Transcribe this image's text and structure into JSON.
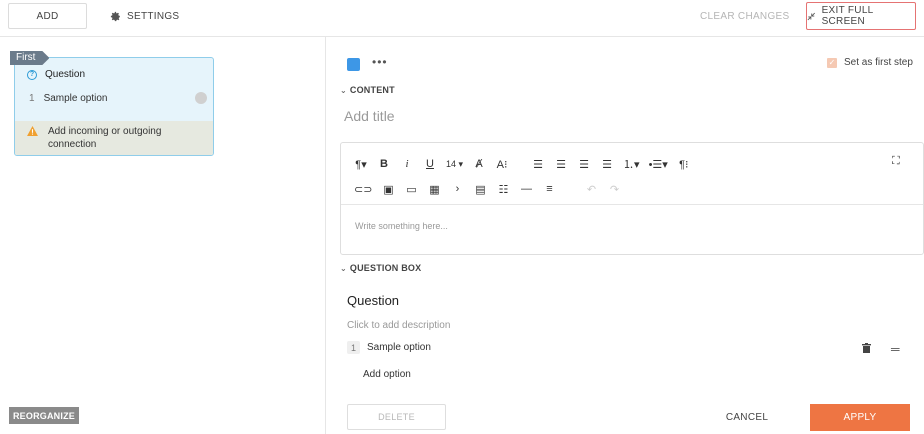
{
  "toolbar": {
    "add_label": "ADD",
    "settings_label": "SETTINGS",
    "clear_label": "CLEAR CHANGES",
    "exit_fullscreen_label": "EXIT FULL SCREEN"
  },
  "canvas": {
    "node": {
      "tag": "First",
      "question_label": "Question",
      "option_number": "1",
      "option_label": "Sample option",
      "warning": "Add incoming or outgoing connection"
    },
    "reorganize_label": "REORGANIZE"
  },
  "editor": {
    "color": "#3d97e6",
    "more": "•••",
    "first_step_label": "Set as first step",
    "content_section": "CONTENT",
    "title_placeholder": "Add title",
    "font_size": "14",
    "body_placeholder": "Write something here...",
    "question_section": "QUESTION BOX",
    "question_title": "Question",
    "question_desc_placeholder": "Click to add description",
    "option_number": "1",
    "option_label": "Sample option",
    "add_option_label": "Add option",
    "delete_label": "DELETE",
    "cancel_label": "CANCEL",
    "apply_label": "APPLY"
  },
  "colors": {
    "accent": "#ee7543",
    "node_border": "#8fcdea",
    "node_bg": "#e6f4fb",
    "warning": "#f0a030"
  }
}
